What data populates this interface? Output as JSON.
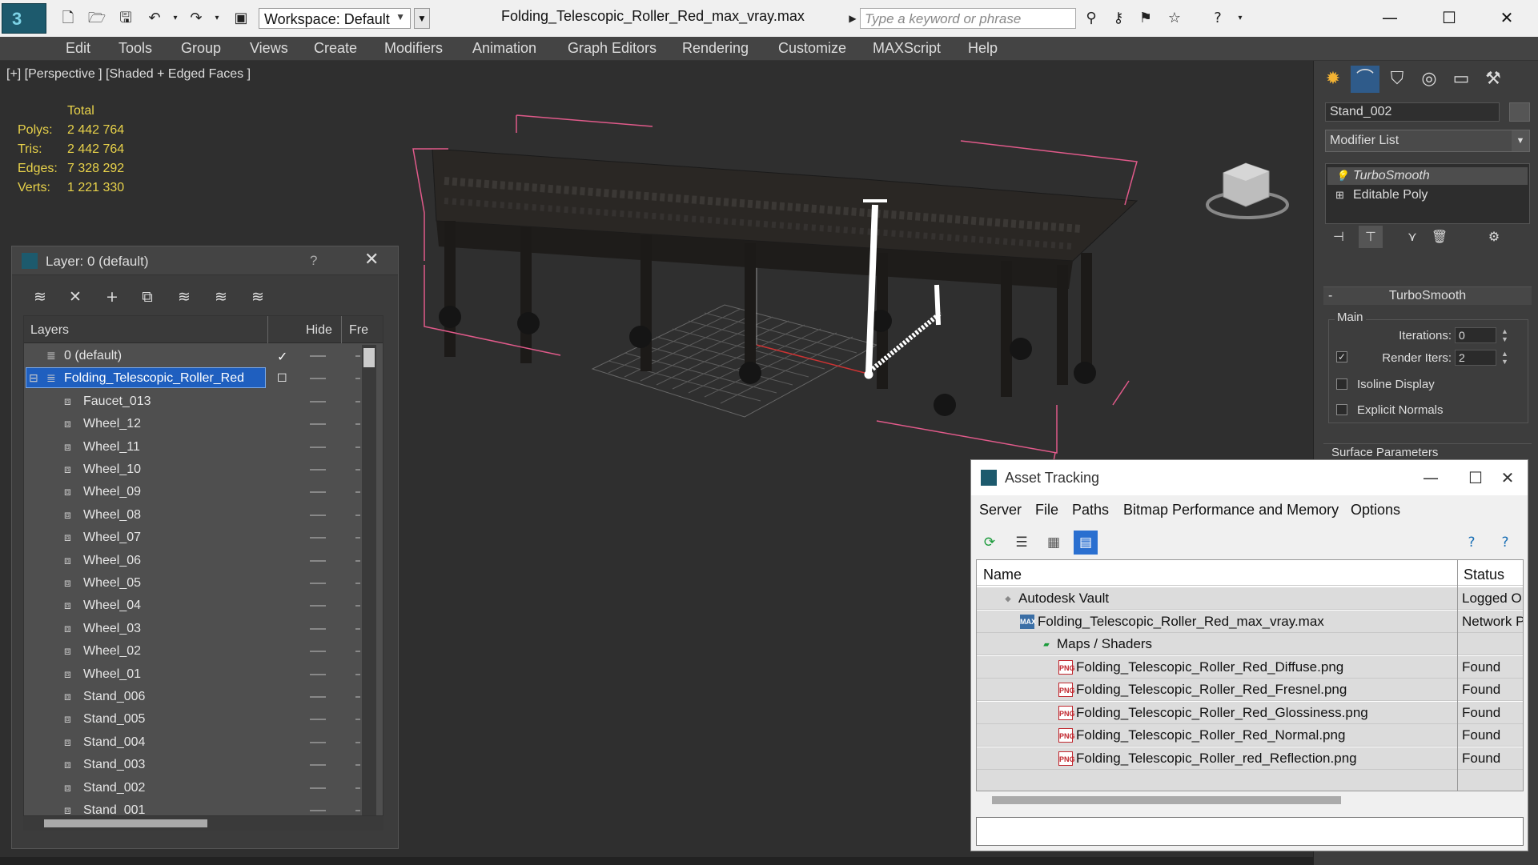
{
  "window": {
    "doc_title": "Folding_Telescopic_Roller_Red_max_vray.max",
    "workspace": "Workspace: Default",
    "search_placeholder": "Type a keyword or phrase"
  },
  "menu": [
    "Edit",
    "Tools",
    "Group",
    "Views",
    "Create",
    "Modifiers",
    "Animation",
    "Graph Editors",
    "Rendering",
    "Customize",
    "MAXScript",
    "Help"
  ],
  "viewport": {
    "label": "[+] [Perspective ] [Shaded + Edged Faces ]",
    "stats_header": "Total",
    "stats": [
      {
        "k": "Polys:",
        "v": "2 442 764"
      },
      {
        "k": "Tris:",
        "v": "2 442 764"
      },
      {
        "k": "Edges:",
        "v": "7 328 292"
      },
      {
        "k": "Verts:",
        "v": "1 221 330"
      }
    ]
  },
  "command_panel": {
    "object_name": "Stand_002",
    "modifier_list": "Modifier List",
    "stack": [
      "TurboSmooth",
      "Editable Poly"
    ],
    "rollout_title": "TurboSmooth",
    "group_main": "Main",
    "iterations_label": "Iterations:",
    "iterations_value": "0",
    "render_iters_label": "Render Iters:",
    "render_iters_value": "2",
    "isoline_label": "Isoline Display",
    "explicit_normals_label": "Explicit Normals",
    "surface_params": "Surface Parameters"
  },
  "layer_dialog": {
    "title": "Layer: 0 (default)",
    "help": "?",
    "col_layers": "Layers",
    "col_hide": "Hide",
    "col_freeze": "Fre",
    "rows": [
      {
        "name": "0 (default)",
        "type": "layer",
        "indent": 0
      },
      {
        "name": "Folding_Telescopic_Roller_Red",
        "type": "layer",
        "indent": 0,
        "selected": true
      },
      {
        "name": "Faucet_013",
        "type": "object",
        "indent": 1
      },
      {
        "name": "Wheel_12",
        "type": "object",
        "indent": 1
      },
      {
        "name": "Wheel_11",
        "type": "object",
        "indent": 1
      },
      {
        "name": "Wheel_10",
        "type": "object",
        "indent": 1
      },
      {
        "name": "Wheel_09",
        "type": "object",
        "indent": 1
      },
      {
        "name": "Wheel_08",
        "type": "object",
        "indent": 1
      },
      {
        "name": "Wheel_07",
        "type": "object",
        "indent": 1
      },
      {
        "name": "Wheel_06",
        "type": "object",
        "indent": 1
      },
      {
        "name": "Wheel_05",
        "type": "object",
        "indent": 1
      },
      {
        "name": "Wheel_04",
        "type": "object",
        "indent": 1
      },
      {
        "name": "Wheel_03",
        "type": "object",
        "indent": 1
      },
      {
        "name": "Wheel_02",
        "type": "object",
        "indent": 1
      },
      {
        "name": "Wheel_01",
        "type": "object",
        "indent": 1
      },
      {
        "name": "Stand_006",
        "type": "object",
        "indent": 1
      },
      {
        "name": "Stand_005",
        "type": "object",
        "indent": 1
      },
      {
        "name": "Stand_004",
        "type": "object",
        "indent": 1
      },
      {
        "name": "Stand_003",
        "type": "object",
        "indent": 1
      },
      {
        "name": "Stand_002",
        "type": "object",
        "indent": 1
      },
      {
        "name": "Stand_001",
        "type": "object",
        "indent": 1
      }
    ]
  },
  "asset_tracking": {
    "title": "Asset Tracking",
    "menu": [
      "Server",
      "File",
      "Paths",
      "Bitmap Performance and Memory",
      "Options"
    ],
    "col_name": "Name",
    "col_status": "Status",
    "rows": [
      {
        "name": "Autodesk Vault",
        "status": "Logged O",
        "icon": "vault-icon",
        "level": 0
      },
      {
        "name": "Folding_Telescopic_Roller_Red_max_vray.max",
        "status": "Network P",
        "icon": "max-file-icon",
        "level": 1
      },
      {
        "name": "Maps / Shaders",
        "status": "",
        "icon": "maps-folder-icon",
        "level": 2
      },
      {
        "name": "Folding_Telescopic_Roller_Red_Diffuse.png",
        "status": "Found",
        "icon": "png-icon",
        "level": 3
      },
      {
        "name": "Folding_Telescopic_Roller_Red_Fresnel.png",
        "status": "Found",
        "icon": "png-icon",
        "level": 3
      },
      {
        "name": "Folding_Telescopic_Roller_Red_Glossiness.png",
        "status": "Found",
        "icon": "png-icon",
        "level": 3
      },
      {
        "name": "Folding_Telescopic_Roller_Red_Normal.png",
        "status": "Found",
        "icon": "png-icon",
        "level": 3
      },
      {
        "name": "Folding_Telescopic_Roller_red_Reflection.png",
        "status": "Found",
        "icon": "png-icon",
        "level": 3
      }
    ]
  },
  "colors": {
    "stats": "#e8d24a",
    "selection": "#1f5fbf",
    "bbox": "#e05a8a",
    "viewport_bg": "#2f2f2f"
  }
}
